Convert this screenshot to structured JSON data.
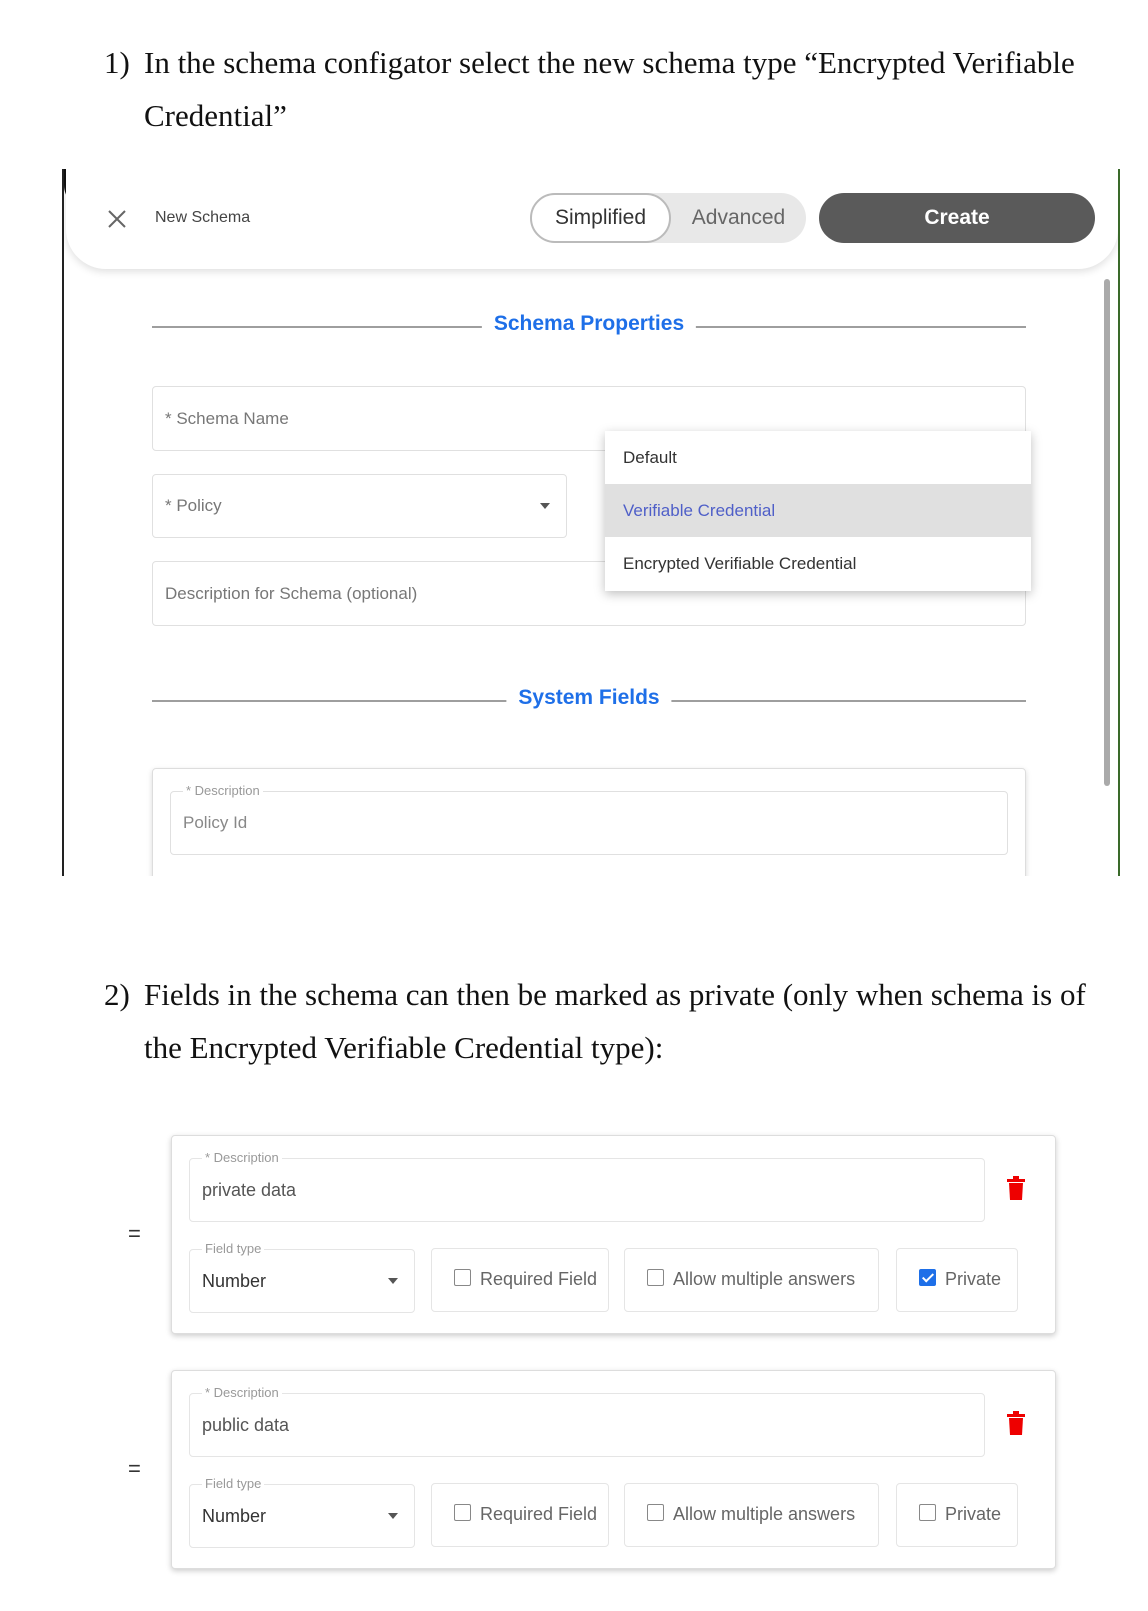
{
  "step1": {
    "number": "1)",
    "line1": "In the schema configator select the new schema type “Encrypted Verifiable",
    "line2": "Credential”"
  },
  "header": {
    "close_icon": "close-icon",
    "title": "New Schema",
    "mode_simplified": "Simplified",
    "mode_advanced": "Advanced",
    "create_label": "Create"
  },
  "schema_properties": {
    "heading": "Schema Properties",
    "schema_name_placeholder": "* Schema Name",
    "policy_placeholder": "* Policy",
    "description_placeholder": "Description for Schema (optional)"
  },
  "type_menu": {
    "options": [
      "Default",
      "Verifiable Credential",
      "Encrypted Verifiable Credential"
    ],
    "highlighted": "Verifiable Credential"
  },
  "system_fields": {
    "heading": "System Fields",
    "field_label": "* Description",
    "field_value": "Policy Id"
  },
  "step2": {
    "number": "2)",
    "line1": "Fields in the schema can then be marked as private (only when schema is of",
    "line2": "the Encrypted Verifiable Credential type):"
  },
  "fields": [
    {
      "description_label": "* Description",
      "description": "private data",
      "field_type_label": "Field type",
      "field_type": "Number",
      "required_label": "Required Field",
      "required": false,
      "multiple_label": "Allow multiple answers",
      "multiple": false,
      "private_label": "Private",
      "private": true
    },
    {
      "description_label": "* Description",
      "description": "public data",
      "field_type_label": "Field type",
      "field_type": "Number",
      "required_label": "Required Field",
      "required": false,
      "multiple_label": "Allow multiple answers",
      "multiple": false,
      "private_label": "Private",
      "private": false
    }
  ],
  "colors": {
    "accent": "#1e6fe8",
    "delete": "#ee0000",
    "create_button": "#5a5a5a"
  }
}
